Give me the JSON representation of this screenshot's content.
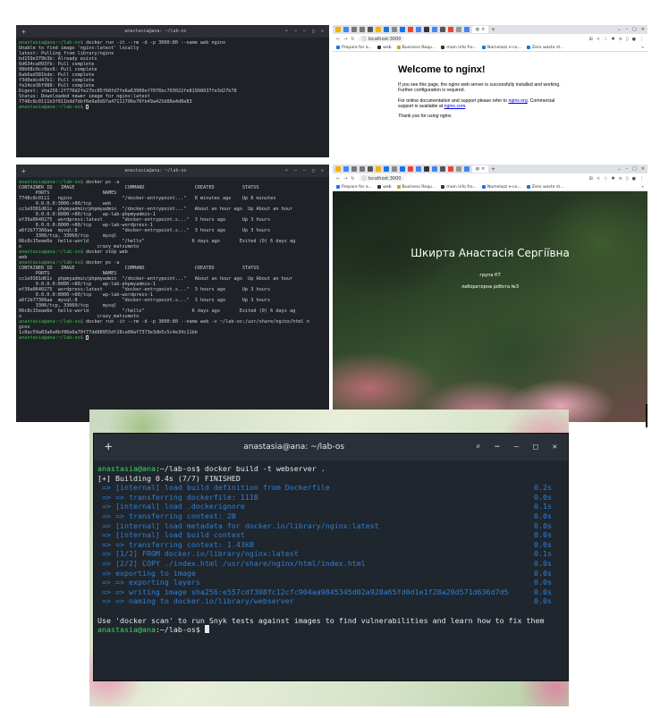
{
  "terminal1": {
    "title": "anastasia@ana: ~/lab-os",
    "lines": [
      {
        "prompt": "anastasia@ana:~/lab-os$",
        "text": " docker run -it --rm -d -p 3000:80 --name web nginx"
      },
      {
        "text": "Unable to find image 'nginx:latest' locally"
      },
      {
        "text": "latest: Pulling from library/nginx"
      },
      {
        "text": "bd159e379b3b: Already exists"
      },
      {
        "text": "6d634ca093fb: Pull complete"
      },
      {
        "text": "98b08c0cc0ec6: Pull complete"
      },
      {
        "text": "6ab6ad381bde: Pull complete"
      },
      {
        "text": "f3d0edcd47b1: Pull complete"
      },
      {
        "text": "fe24ce36f988: Pull complete"
      },
      {
        "text": "Digest: sha256:2f770d2fe27bc85f68fd7fe6a63900ef7076bc703022fe81998037fe3d27b78"
      },
      {
        "text": "Status: Downloaded newer image for nginx:latest"
      },
      {
        "text": "7748c8c0111b3f911bdd7dbf6e9a0d97a47111706e70fb49a425d88a4d8e83"
      },
      {
        "prompt": "anastasia@ana:~/lab-os$",
        "text": " ",
        "cursor": true
      }
    ]
  },
  "browser1": {
    "url": "localhost:3000",
    "bookmarks": [
      "Prepare for a...",
      "web",
      "Business Requ...",
      "main info fro...",
      "Namelazz e-co...",
      "Zero waste st..."
    ],
    "heading": "Welcome to nginx!",
    "para1": "If you see this page, the nginx web server is successfully installed and working. Further configuration is required.",
    "para2_prefix": "For online documentation and support please refer to ",
    "link1": "nginx.org",
    "para2_mid": ". Commercial support is available at ",
    "link2": "nginx.com",
    "para2_suffix": ".",
    "thanks": "Thank you for using nginx."
  },
  "terminal2": {
    "lines": [
      {
        "prompt": "anastasia@ana:~/lab-os$",
        "text": " docker ps -a"
      },
      {
        "text": "CONTAINER ID   IMAGE                  COMMAND                  CREATED          STATUS"
      },
      {
        "text": "      PORTS                   NAMES"
      },
      {
        "text": "7748c8c0111   nginx                  \"/docker-entrypoint...\"   8 minutes ago    Up 8 minutes"
      },
      {
        "text": "      0.0.0.0:3000->80/tcp    web"
      },
      {
        "text": "cc1e9381d61c  phpmyadmin/phpmyadmin  \"/docker-entrypoint...\"   About an hour ago  Up About an hour"
      },
      {
        "text": "      0.0.0.0:8080->80/tcp    wp-lab-phpmyadmin-1"
      },
      {
        "text": "ef39a0640275  wordpress:latest       \"docker-entrypoint.s...\"  3 hours ago      Up 3 hours"
      },
      {
        "text": "      0.0.0.0:8000->80/tcp    wp-lab-wordpress-1"
      },
      {
        "text": "a6f2b77366aa  mysql:8                \"docker-entrypoint.s...\"  3 hours ago      Up 3 hours"
      },
      {
        "text": "      3306/tcp, 33060/tcp     mysql"
      },
      {
        "text": "06c8c15eae6e  hello-world            \"/hello\"                 6 days ago       Exited (0) 6 days ag"
      },
      {
        "text": "o                           crazy_matsumoto"
      },
      {
        "prompt": "anastasia@ana:~/lab-os$",
        "text": " docker stop web"
      },
      {
        "text": "web"
      },
      {
        "prompt": "anastasia@ana:~/lab-os$",
        "text": " docker ps -a"
      },
      {
        "text": "CONTAINER ID   IMAGE                  COMMAND                  CREATED          STATUS"
      },
      {
        "text": "      PORTS                   NAMES"
      },
      {
        "text": "cc1e9381d61c  phpmyadmin/phpmyadmin  \"/docker-entrypoint...\"   About an hour ago  Up About an hour"
      },
      {
        "text": "      0.0.0.0:8080->80/tcp    wp-lab-phpmyadmin-1"
      },
      {
        "text": "ef39a0640275  wordpress:latest       \"docker-entrypoint.s...\"  3 hours ago      Up 3 hours"
      },
      {
        "text": "      0.0.0.0:8000->80/tcp    wp-lab-wordpress-1"
      },
      {
        "text": "a6f2b77366aa  mysql:8                \"docker-entrypoint.s...\"  3 hours ago      Up 3 hours"
      },
      {
        "text": "      3306/tcp, 33060/tcp     mysql"
      },
      {
        "text": "06c8c15eae6e  hello-world            \"/hello\"                 6 days ago       Exited (0) 6 days ag"
      },
      {
        "text": "o                           crazy_matsumoto"
      },
      {
        "prompt": "anastasia@ana:~/lab-os$",
        "text": " docker run -it --rm -d -p 3000:80 --name web -v ~/lab-os:/usr/share/nginx/html n"
      },
      {
        "text": "ginx"
      },
      {
        "text": "1c8ac59a83a6a0bf86e0a70f77dd88955df28ca08af7373e3db5c5c4e34c11bb"
      },
      {
        "prompt": "anastasia@ana:~/lab-os$",
        "text": " ",
        "cursor": true
      }
    ]
  },
  "browser2": {
    "url": "localhost:3000",
    "bookmarks": [
      "Prepare for a...",
      "web",
      "Business Requ...",
      "main info fro...",
      "Namelazz e-co...",
      "Zero waste st..."
    ],
    "name": "Шкирта Анастасія Сергіївна",
    "group": "група КТ",
    "lab": "лабораторна робота №3"
  },
  "terminal3": {
    "title": "anastasia@ana: ~/lab-os",
    "lines": [
      {
        "prompt": "anastasia@ana",
        "path": ":~/lab-os",
        "text": "$ docker build -t webserver ."
      },
      {
        "text": "[+] Building 0.4s (7/7) FINISHED"
      },
      {
        "blue": true,
        "text": " => [internal] load build definition from Dockerfile",
        "time": "0.2s"
      },
      {
        "blue": true,
        "text": " => => transferring dockerfile: 111B",
        "time": "0.0s"
      },
      {
        "blue": true,
        "text": " => [internal] load .dockerignore",
        "time": "0.1s"
      },
      {
        "blue": true,
        "text": " => => transferring context: 2B",
        "time": "0.0s"
      },
      {
        "blue": true,
        "text": " => [internal] load metadata for docker.io/library/nginx:latest",
        "time": "0.0s"
      },
      {
        "blue": true,
        "text": " => [internal] load build context",
        "time": "0.0s"
      },
      {
        "blue": true,
        "text": " => => transferring context: 1.43kB",
        "time": "0.0s"
      },
      {
        "blue": true,
        "text": " => [1/2] FROM docker.io/library/nginx:latest",
        "time": "0.1s"
      },
      {
        "blue": true,
        "text": " => [2/2] COPY ./index.html /usr/share/nginx/html/index.html",
        "time": "0.0s"
      },
      {
        "blue": true,
        "text": " => exporting to image",
        "time": "0.0s"
      },
      {
        "blue": true,
        "text": " => => exporting layers",
        "time": "0.0s"
      },
      {
        "blue": true,
        "text": " => => writing image sha256:e557cdf308fc12cfc904aa9845345d02a928a65fd0d1e1f28a20d571d636d7d5",
        "time": "0.0s"
      },
      {
        "blue": true,
        "text": " => => naming to docker.io/library/webserver",
        "time": "0.0s"
      },
      {
        "text": ""
      },
      {
        "text": "Use 'docker scan' to run Snyk tests against images to find vulnerabilities and learn how to fix them"
      },
      {
        "prompt": "anastasia@ana",
        "path": ":~/lab-os",
        "text": "$ ",
        "cursor": true
      }
    ]
  }
}
